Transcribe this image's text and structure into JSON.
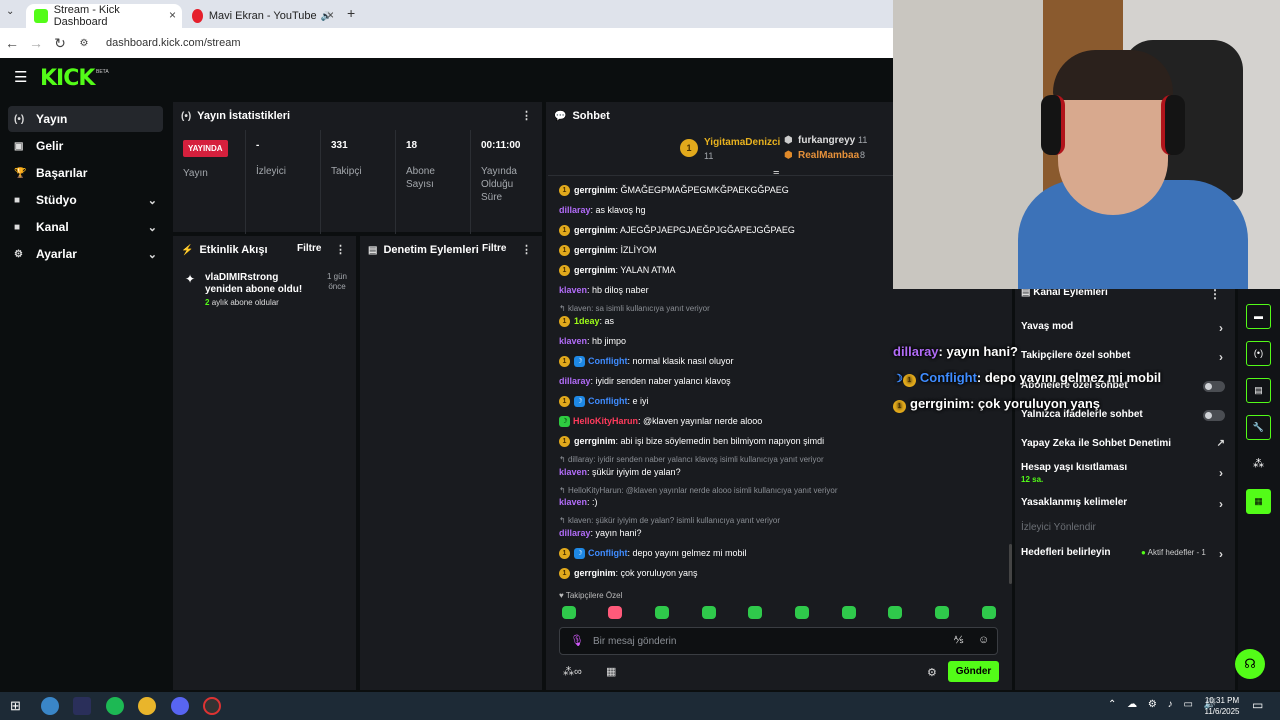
{
  "browser": {
    "tabs": [
      {
        "title": "Stream - Kick Dashboard"
      },
      {
        "title": "Mavi Ekran - YouTube Music"
      }
    ],
    "url": "dashboard.kick.com/stream"
  },
  "brand": {
    "logo": "KICK",
    "beta": "BETA",
    "accent": "#53fc18"
  },
  "sidebar": {
    "items": [
      {
        "label": "Yayın",
        "icon": "broadcast-icon"
      },
      {
        "label": "Gelir",
        "icon": "wallet-icon"
      },
      {
        "label": "Başarılar",
        "icon": "trophy-icon"
      },
      {
        "label": "Stüdyo",
        "icon": "camera-icon"
      },
      {
        "label": "Kanal",
        "icon": "user-icon"
      },
      {
        "label": "Ayarlar",
        "icon": "gear-icon"
      }
    ]
  },
  "stats": {
    "title": "Yayın İstatistikleri",
    "live_badge": "YAYINDA",
    "live_label": "Yayın",
    "viewers_value": "-",
    "viewers_label": "İzleyici",
    "followers_value": "331",
    "followers_label": "Takipçi",
    "subs_value": "18",
    "subs_label": "Abone Sayısı",
    "duration_value": "00:11:00",
    "duration_label": "Yayında Olduğu Süre"
  },
  "activity": {
    "title": "Etkinlik Akışı",
    "filter": "Filtre",
    "event_text": "vlaDIMIRstrong yeniden abone oldu!",
    "event_sub_count": "2",
    "event_sub_text": "aylık abone oldular",
    "event_time": "1 gün önce"
  },
  "moderation": {
    "title": "Denetim Eylemleri",
    "filter": "Filtre"
  },
  "chat": {
    "title": "Sohbet",
    "top": [
      {
        "name": "YigitamaDenizci",
        "count": "11"
      },
      {
        "name": "furkangreyy",
        "count": "11"
      },
      {
        "name": "RealMambaa",
        "count": "8"
      }
    ],
    "messages": [
      {
        "user": "gerrginim",
        "text": ": ĞMAĞEGPMAĞPEGMKĞPAEKGĞPAEG"
      },
      {
        "user": "dillaray",
        "text": ": as klavoş hg"
      },
      {
        "user": "gerrginim",
        "text": ": AJEGĞPJAEPGJAEĞPJGĞAPEJGĞPAEG"
      },
      {
        "user": "gerrginim",
        "text": ": İZLİYOM"
      },
      {
        "user": "gerrginim",
        "text": ": YALAN ATMA"
      },
      {
        "user": "klaven",
        "text": ": hb diloş naber"
      },
      {
        "reply": "klaven: sa isimli kullanıcıya yanıt veriyor",
        "user": "1deay",
        "text": ": as"
      },
      {
        "user": "klaven",
        "text": ": hb jimpo"
      },
      {
        "user": "Conflight",
        "text": ": normal klasik nasıl oluyor"
      },
      {
        "user": "dillaray",
        "text": ": iyidir senden naber yalancı klavoş"
      },
      {
        "user": "Conflight",
        "text": ": e iyi"
      },
      {
        "user": "HelloKityHarun",
        "text": ": @klaven yayınlar nerde alooo"
      },
      {
        "user": "gerrginim",
        "text": ": abi işi bize söylemedin ben bilmiyom napıyon şimdi"
      },
      {
        "reply": "dillaray: iyidir senden naber yalancı klavoş isimli kullanıcıya yanıt veriyor",
        "user": "klaven",
        "text": ": şükür iyiyim de yalan?"
      },
      {
        "reply": "HelloKityHarun: @klaven yayınlar nerde alooo isimli kullanıcıya yanıt veriyor",
        "user": "klaven",
        "text": ": :)"
      },
      {
        "reply": "klaven: şükür iyiyim de yalan? isimli kullanıcıya yanıt veriyor",
        "user": "dillaray",
        "text": ": yayın hani?"
      },
      {
        "user": "Conflight",
        "text": ": depo yayını gelmez mi mobil"
      },
      {
        "user": "gerrginim",
        "text": ": çok yoruluyon yanş"
      }
    ],
    "followers_only": "Takipçilere Özel",
    "input_placeholder": "Bir mesaj gönderin",
    "send": "Gönder",
    "colors": {
      "gerrginim": "#ffffff",
      "dillaray": "#b16cf7",
      "klaven": "#b16cf7",
      "Conflight": "#3f8cff",
      "HelloKityHarun": "#ff3b5c",
      "1deay": "#9efc18"
    }
  },
  "channel_actions": {
    "title": "Kanal Eylemleri",
    "items": [
      {
        "label": "Yavaş mod"
      },
      {
        "label": "Takipçilere özel sohbet"
      },
      {
        "label": "Abonelere özel sohbet"
      },
      {
        "label": "Yalnızca ifadelerle sohbet"
      },
      {
        "label": "Yapay Zeka ile Sohbet Denetimi"
      },
      {
        "label": "Hesap yaşı kısıtlaması",
        "sub": "12 sa."
      },
      {
        "label": "Yasaklanmış kelimeler"
      },
      {
        "label": "İzleyici Yönlendir"
      },
      {
        "label": "Hedefleri belirleyin",
        "extra": "Aktif hedefler - 1"
      }
    ]
  },
  "overlay_chat": [
    {
      "user": "dillaray",
      "text": ": yayın hani?"
    },
    {
      "user": "Conflight",
      "text": ": depo yayını gelmez mi mobil"
    },
    {
      "user": "gerrginim",
      "text": ": çok yoruluyon yanş"
    }
  ],
  "taskbar": {
    "time": "10:31 PM",
    "date": "11/6/2025"
  }
}
